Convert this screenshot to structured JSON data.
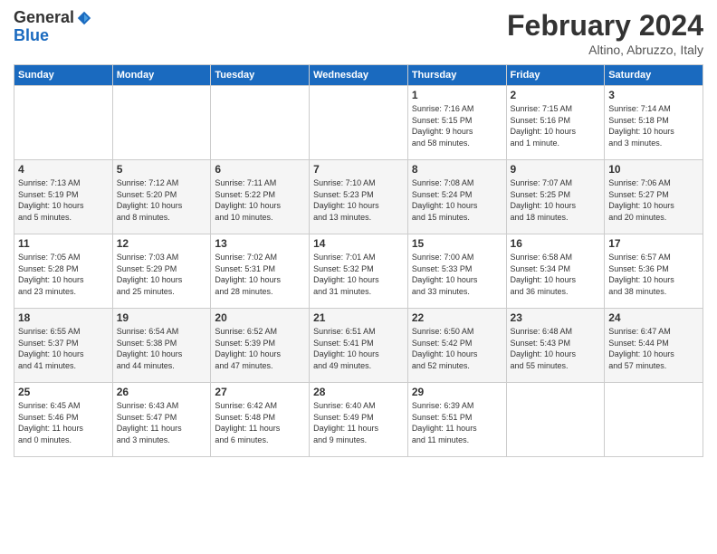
{
  "header": {
    "logo_line1": "General",
    "logo_line2": "Blue",
    "title": "February 2024",
    "location": "Altino, Abruzzo, Italy"
  },
  "weekdays": [
    "Sunday",
    "Monday",
    "Tuesday",
    "Wednesday",
    "Thursday",
    "Friday",
    "Saturday"
  ],
  "weeks": [
    [
      {
        "day": "",
        "info": ""
      },
      {
        "day": "",
        "info": ""
      },
      {
        "day": "",
        "info": ""
      },
      {
        "day": "",
        "info": ""
      },
      {
        "day": "1",
        "info": "Sunrise: 7:16 AM\nSunset: 5:15 PM\nDaylight: 9 hours\nand 58 minutes."
      },
      {
        "day": "2",
        "info": "Sunrise: 7:15 AM\nSunset: 5:16 PM\nDaylight: 10 hours\nand 1 minute."
      },
      {
        "day": "3",
        "info": "Sunrise: 7:14 AM\nSunset: 5:18 PM\nDaylight: 10 hours\nand 3 minutes."
      }
    ],
    [
      {
        "day": "4",
        "info": "Sunrise: 7:13 AM\nSunset: 5:19 PM\nDaylight: 10 hours\nand 5 minutes."
      },
      {
        "day": "5",
        "info": "Sunrise: 7:12 AM\nSunset: 5:20 PM\nDaylight: 10 hours\nand 8 minutes."
      },
      {
        "day": "6",
        "info": "Sunrise: 7:11 AM\nSunset: 5:22 PM\nDaylight: 10 hours\nand 10 minutes."
      },
      {
        "day": "7",
        "info": "Sunrise: 7:10 AM\nSunset: 5:23 PM\nDaylight: 10 hours\nand 13 minutes."
      },
      {
        "day": "8",
        "info": "Sunrise: 7:08 AM\nSunset: 5:24 PM\nDaylight: 10 hours\nand 15 minutes."
      },
      {
        "day": "9",
        "info": "Sunrise: 7:07 AM\nSunset: 5:25 PM\nDaylight: 10 hours\nand 18 minutes."
      },
      {
        "day": "10",
        "info": "Sunrise: 7:06 AM\nSunset: 5:27 PM\nDaylight: 10 hours\nand 20 minutes."
      }
    ],
    [
      {
        "day": "11",
        "info": "Sunrise: 7:05 AM\nSunset: 5:28 PM\nDaylight: 10 hours\nand 23 minutes."
      },
      {
        "day": "12",
        "info": "Sunrise: 7:03 AM\nSunset: 5:29 PM\nDaylight: 10 hours\nand 25 minutes."
      },
      {
        "day": "13",
        "info": "Sunrise: 7:02 AM\nSunset: 5:31 PM\nDaylight: 10 hours\nand 28 minutes."
      },
      {
        "day": "14",
        "info": "Sunrise: 7:01 AM\nSunset: 5:32 PM\nDaylight: 10 hours\nand 31 minutes."
      },
      {
        "day": "15",
        "info": "Sunrise: 7:00 AM\nSunset: 5:33 PM\nDaylight: 10 hours\nand 33 minutes."
      },
      {
        "day": "16",
        "info": "Sunrise: 6:58 AM\nSunset: 5:34 PM\nDaylight: 10 hours\nand 36 minutes."
      },
      {
        "day": "17",
        "info": "Sunrise: 6:57 AM\nSunset: 5:36 PM\nDaylight: 10 hours\nand 38 minutes."
      }
    ],
    [
      {
        "day": "18",
        "info": "Sunrise: 6:55 AM\nSunset: 5:37 PM\nDaylight: 10 hours\nand 41 minutes."
      },
      {
        "day": "19",
        "info": "Sunrise: 6:54 AM\nSunset: 5:38 PM\nDaylight: 10 hours\nand 44 minutes."
      },
      {
        "day": "20",
        "info": "Sunrise: 6:52 AM\nSunset: 5:39 PM\nDaylight: 10 hours\nand 47 minutes."
      },
      {
        "day": "21",
        "info": "Sunrise: 6:51 AM\nSunset: 5:41 PM\nDaylight: 10 hours\nand 49 minutes."
      },
      {
        "day": "22",
        "info": "Sunrise: 6:50 AM\nSunset: 5:42 PM\nDaylight: 10 hours\nand 52 minutes."
      },
      {
        "day": "23",
        "info": "Sunrise: 6:48 AM\nSunset: 5:43 PM\nDaylight: 10 hours\nand 55 minutes."
      },
      {
        "day": "24",
        "info": "Sunrise: 6:47 AM\nSunset: 5:44 PM\nDaylight: 10 hours\nand 57 minutes."
      }
    ],
    [
      {
        "day": "25",
        "info": "Sunrise: 6:45 AM\nSunset: 5:46 PM\nDaylight: 11 hours\nand 0 minutes."
      },
      {
        "day": "26",
        "info": "Sunrise: 6:43 AM\nSunset: 5:47 PM\nDaylight: 11 hours\nand 3 minutes."
      },
      {
        "day": "27",
        "info": "Sunrise: 6:42 AM\nSunset: 5:48 PM\nDaylight: 11 hours\nand 6 minutes."
      },
      {
        "day": "28",
        "info": "Sunrise: 6:40 AM\nSunset: 5:49 PM\nDaylight: 11 hours\nand 9 minutes."
      },
      {
        "day": "29",
        "info": "Sunrise: 6:39 AM\nSunset: 5:51 PM\nDaylight: 11 hours\nand 11 minutes."
      },
      {
        "day": "",
        "info": ""
      },
      {
        "day": "",
        "info": ""
      }
    ]
  ]
}
